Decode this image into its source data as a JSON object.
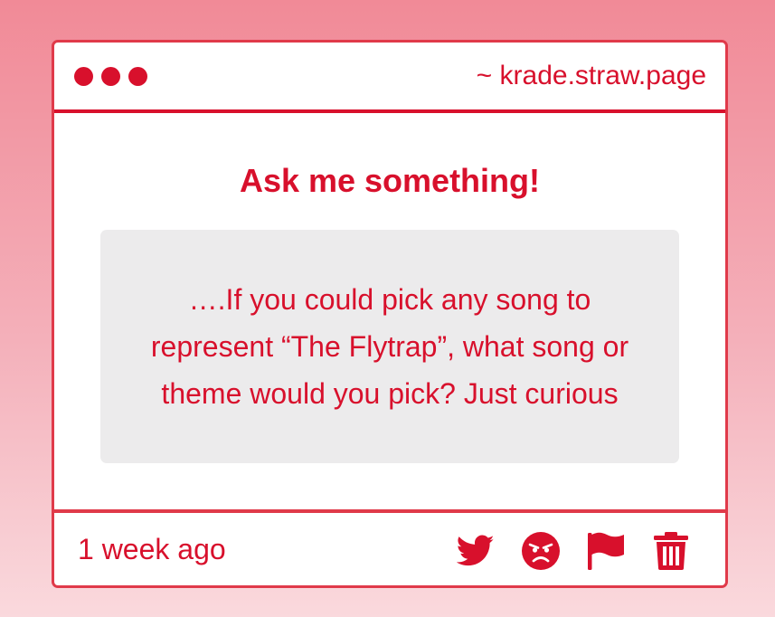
{
  "window": {
    "url": "~ krade.straw.page"
  },
  "main": {
    "heading": "Ask me something!",
    "question": "….If you could pick any song to represent “The Flytrap”, what song or theme would you pick? Just curious"
  },
  "footer": {
    "timestamp": "1 week ago",
    "actions": [
      {
        "icon": "twitter-icon"
      },
      {
        "icon": "angry-face-icon"
      },
      {
        "icon": "flag-icon"
      },
      {
        "icon": "trash-icon"
      }
    ]
  },
  "colors": {
    "accent": "#d8102c",
    "border": "#e03a4a",
    "question_background": "#ecebec",
    "background_top": "#f18a97",
    "background_bottom": "#fad9dd"
  }
}
